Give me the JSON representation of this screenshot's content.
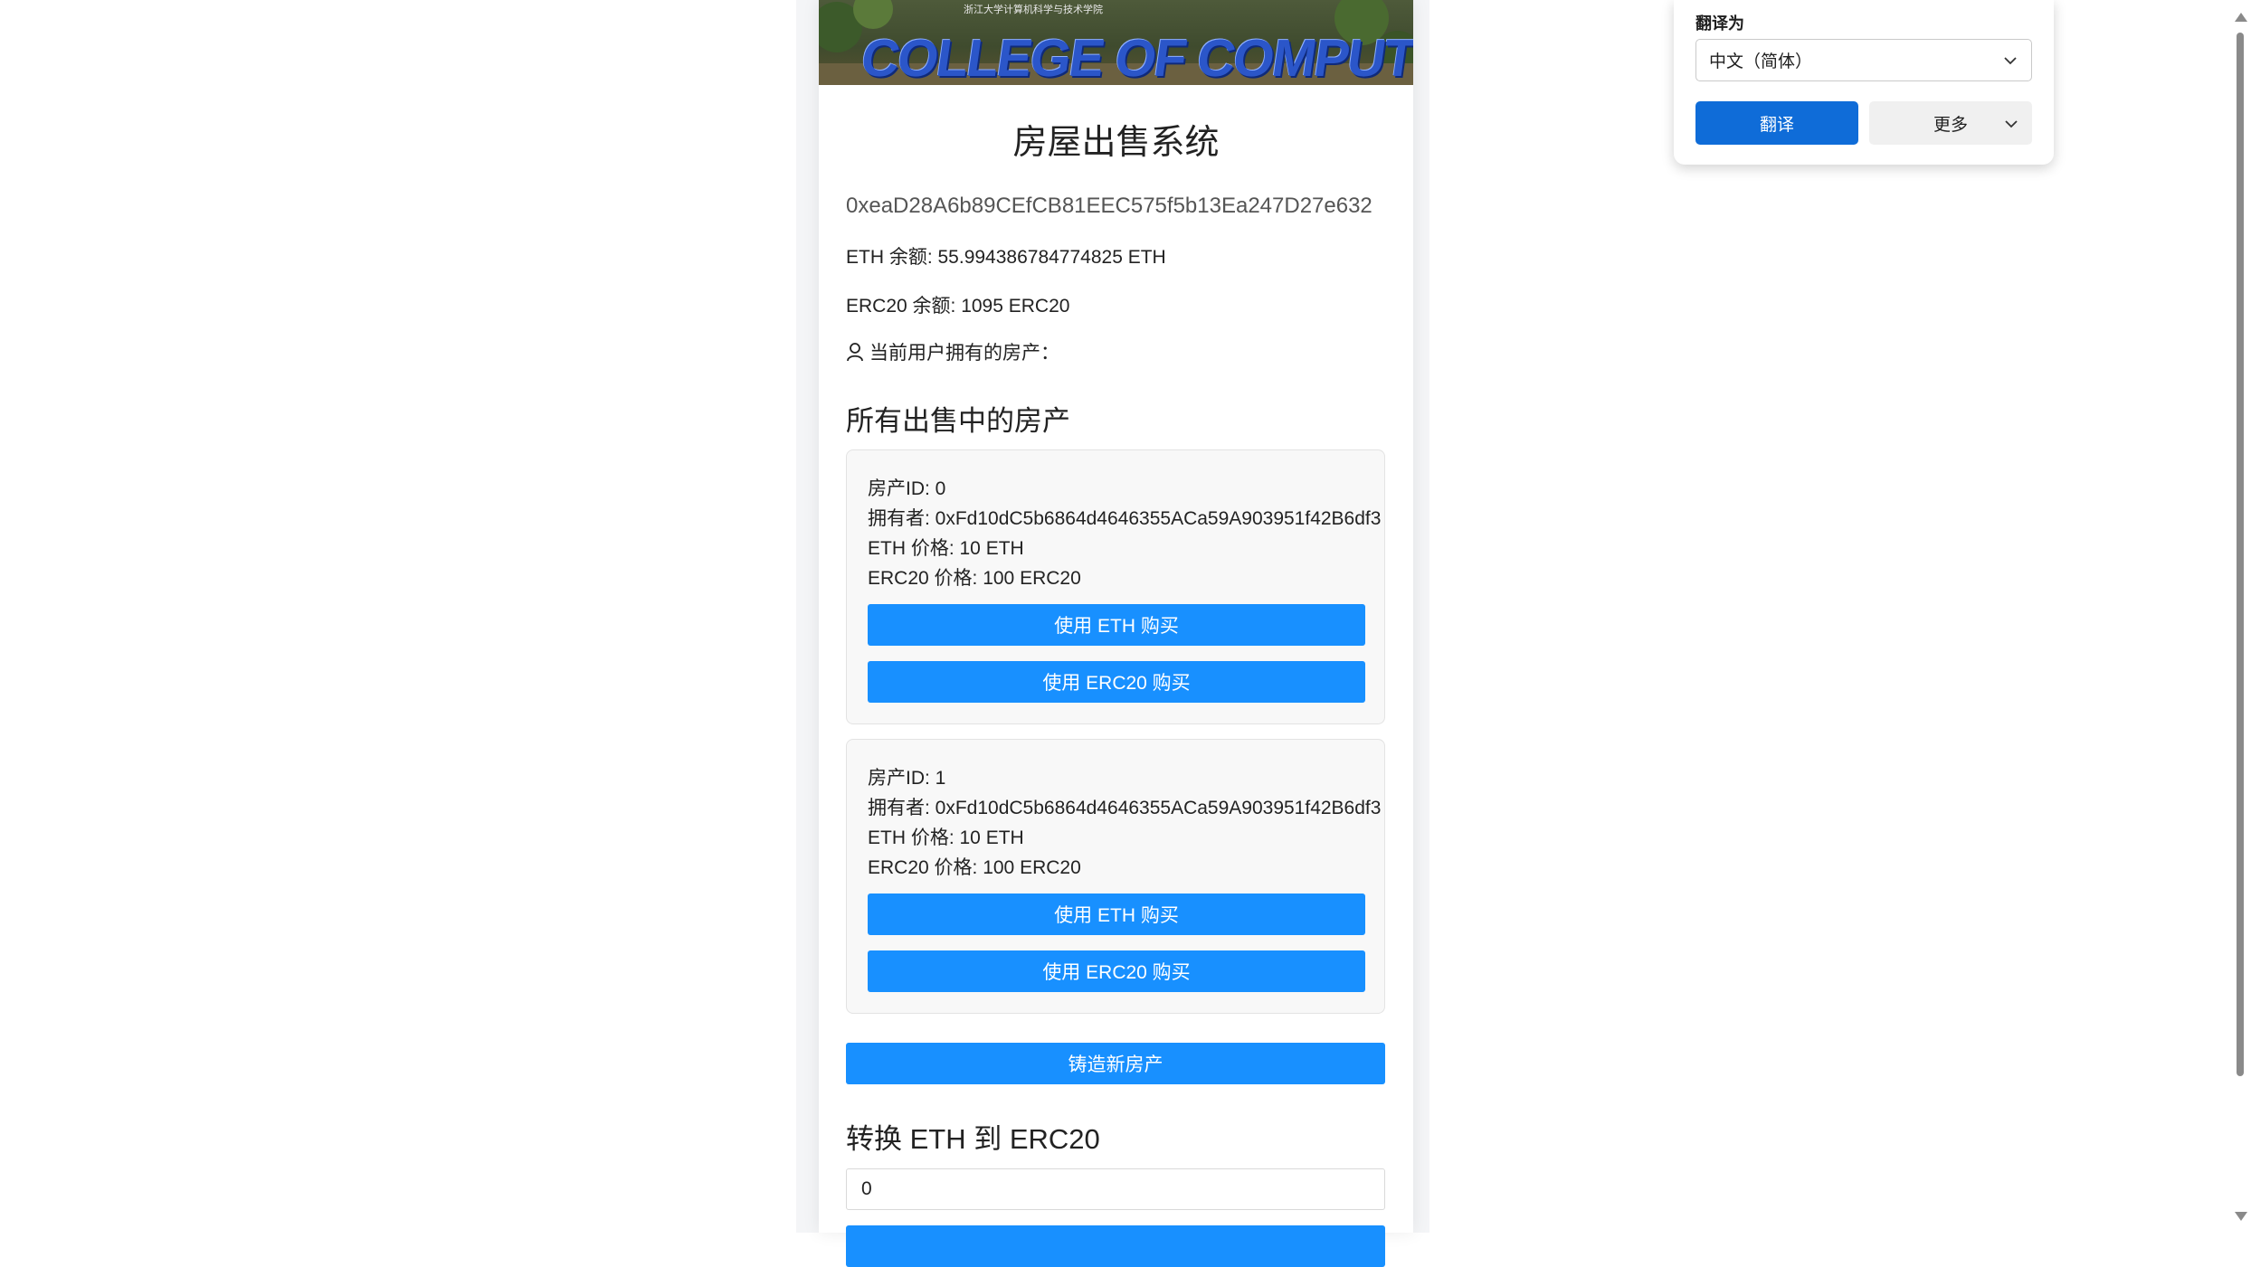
{
  "banner": {
    "text": "COLLEGE OF COMPUTER SCIENCE",
    "subtext": "浙江大学计算机科学与技术学院"
  },
  "header": {
    "title": "房屋出售系统"
  },
  "account": {
    "address": "0xeaD28A6b89CEfCB81EEC575f5b13Ea247D27e632",
    "eth_balance": "ETH 余额: 55.994386784774825 ETH",
    "erc20_balance": "ERC20 余额: 1095 ERC20",
    "owned_label": "当前用户拥有的房产："
  },
  "listings": {
    "title": "所有出售中的房产",
    "items": [
      {
        "id_line": "房产ID: 0",
        "owner_line": "拥有者: 0xFd10dC5b6864d4646355ACa59A903951f42B6df3",
        "eth_price_line": "ETH 价格: 10 ETH",
        "erc20_price_line": "ERC20 价格: 100 ERC20",
        "buy_eth_label": "使用 ETH 购买",
        "buy_erc20_label": "使用 ERC20 购买"
      },
      {
        "id_line": "房产ID: 1",
        "owner_line": "拥有者: 0xFd10dC5b6864d4646355ACa59A903951f42B6df3",
        "eth_price_line": "ETH 价格: 10 ETH",
        "erc20_price_line": "ERC20 价格: 100 ERC20",
        "buy_eth_label": "使用 ETH 购买",
        "buy_erc20_label": "使用 ERC20 购买"
      }
    ],
    "mint_label": "铸造新房产"
  },
  "convert": {
    "title": "转换 ETH 到 ERC20",
    "amount_value": "0"
  },
  "translate_popup": {
    "label": "翻译为",
    "selected_language": "中文（简体）",
    "translate_label": "翻译",
    "more_label": "更多"
  },
  "colors": {
    "primary_button": "#1890ff",
    "translate_button": "#0f6cd8"
  }
}
